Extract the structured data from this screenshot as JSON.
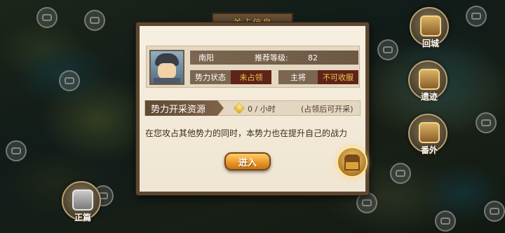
{
  "map": {
    "side_buttons": [
      {
        "label": "回城",
        "icon": "castle-icon"
      },
      {
        "label": "遗迹",
        "icon": "treasure-icon"
      },
      {
        "label": "番外",
        "icon": "scroll-icon"
      },
      {
        "label": "正篇",
        "icon": "crossed-swords-icon"
      }
    ]
  },
  "dialog": {
    "title": "关卡信息",
    "stage_name": "南阳",
    "level_label": "推荐等级:",
    "level_value": "82",
    "status_label": "势力状态",
    "status_value": "未占领",
    "general_label": "主将",
    "general_value": "不可收服",
    "resource_title": "势力开采资源",
    "resource_rate": "0 / 小时",
    "resource_note": "(占领后可开采)",
    "description": "在您攻占其他势力的同时，本势力也在提升自己的战力",
    "enter_button": "进入"
  },
  "colors": {
    "accent_gold": "#f3c04a",
    "status_red": "#5e2418",
    "frame_brown": "#5d4730"
  }
}
